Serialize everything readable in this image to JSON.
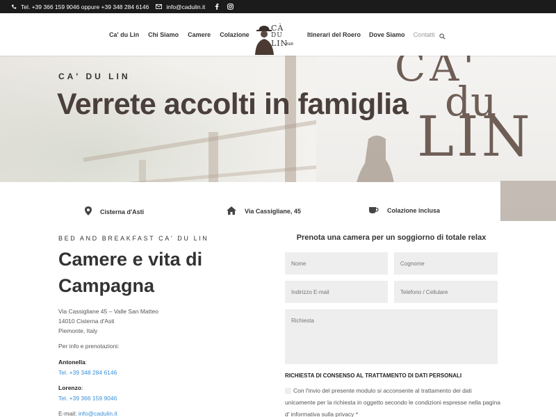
{
  "topbar": {
    "phones": "Tel. +39 366 159 9046 oppure +39 348 284 6146",
    "email": "info@cadulin.it",
    "bg_color": "#1b1b1b"
  },
  "nav": {
    "left_items": [
      "Ca' du Lin",
      "Chi Siamo",
      "Camere",
      "Colazione"
    ],
    "right_items": [
      "Itinerari del Roero",
      "Dove Siamo",
      "Contatti"
    ],
    "logo_text": [
      "CÀ",
      "DU",
      "LIN"
    ],
    "logo_small": "B&B"
  },
  "hero": {
    "subtitle": "CA' DU LIN",
    "title": "Verrete accolti in famiglia",
    "sign": {
      "line1": "CA'",
      "line2": "du",
      "line3": "LIN"
    }
  },
  "features": [
    {
      "icon": "location-pin-icon",
      "label": "Cisterna d'Asti"
    },
    {
      "icon": "home-icon",
      "label": "Via Cassigliane, 45"
    },
    {
      "icon": "coffee-cup-icon",
      "label": "Colazione inclusa"
    }
  ],
  "intro": {
    "eyebrow": "BED AND BREAKFAST CA' DU LIN",
    "heading": "Camere e vita di Campagna",
    "address": [
      "Via Cassigliane 45 – Valle San Matteo",
      "14010 Cisterna d'Asti",
      "Piemonte, Italy"
    ],
    "info_label": "Per info e prenotazioni:",
    "contact1_name": "Antonella",
    "contact1_phone": "Tel. +39 348 284 6146",
    "contact2_name": "Lorenzo",
    "contact2_phone": "Tel. +39 366 159 9046",
    "email_label": "E-mail: ",
    "email": "info@cadulin.it"
  },
  "form": {
    "title": "Prenota una camera per un soggiorno di totale relax",
    "name_placeholder": "Nome",
    "surname_placeholder": "Cognome",
    "email_placeholder": "Indirizzo E-mail",
    "phone_placeholder": "Telefono / Cellulare",
    "request_placeholder": "Richiesta",
    "consent_title": "RICHIESTA DI CONSENSO AL TRATTAMENTO DI DATI PERSONALI",
    "consent_text": "Con l'invio del presente modulo si acconsente al trattamento dei dati unicamente per la richiesta in oggetto secondo le condizioni espresse nella pagina d' informativa sulla privacy *"
  },
  "colors": {
    "accent_link": "#3b8ed8",
    "hero_title": "#4a3f3a"
  }
}
